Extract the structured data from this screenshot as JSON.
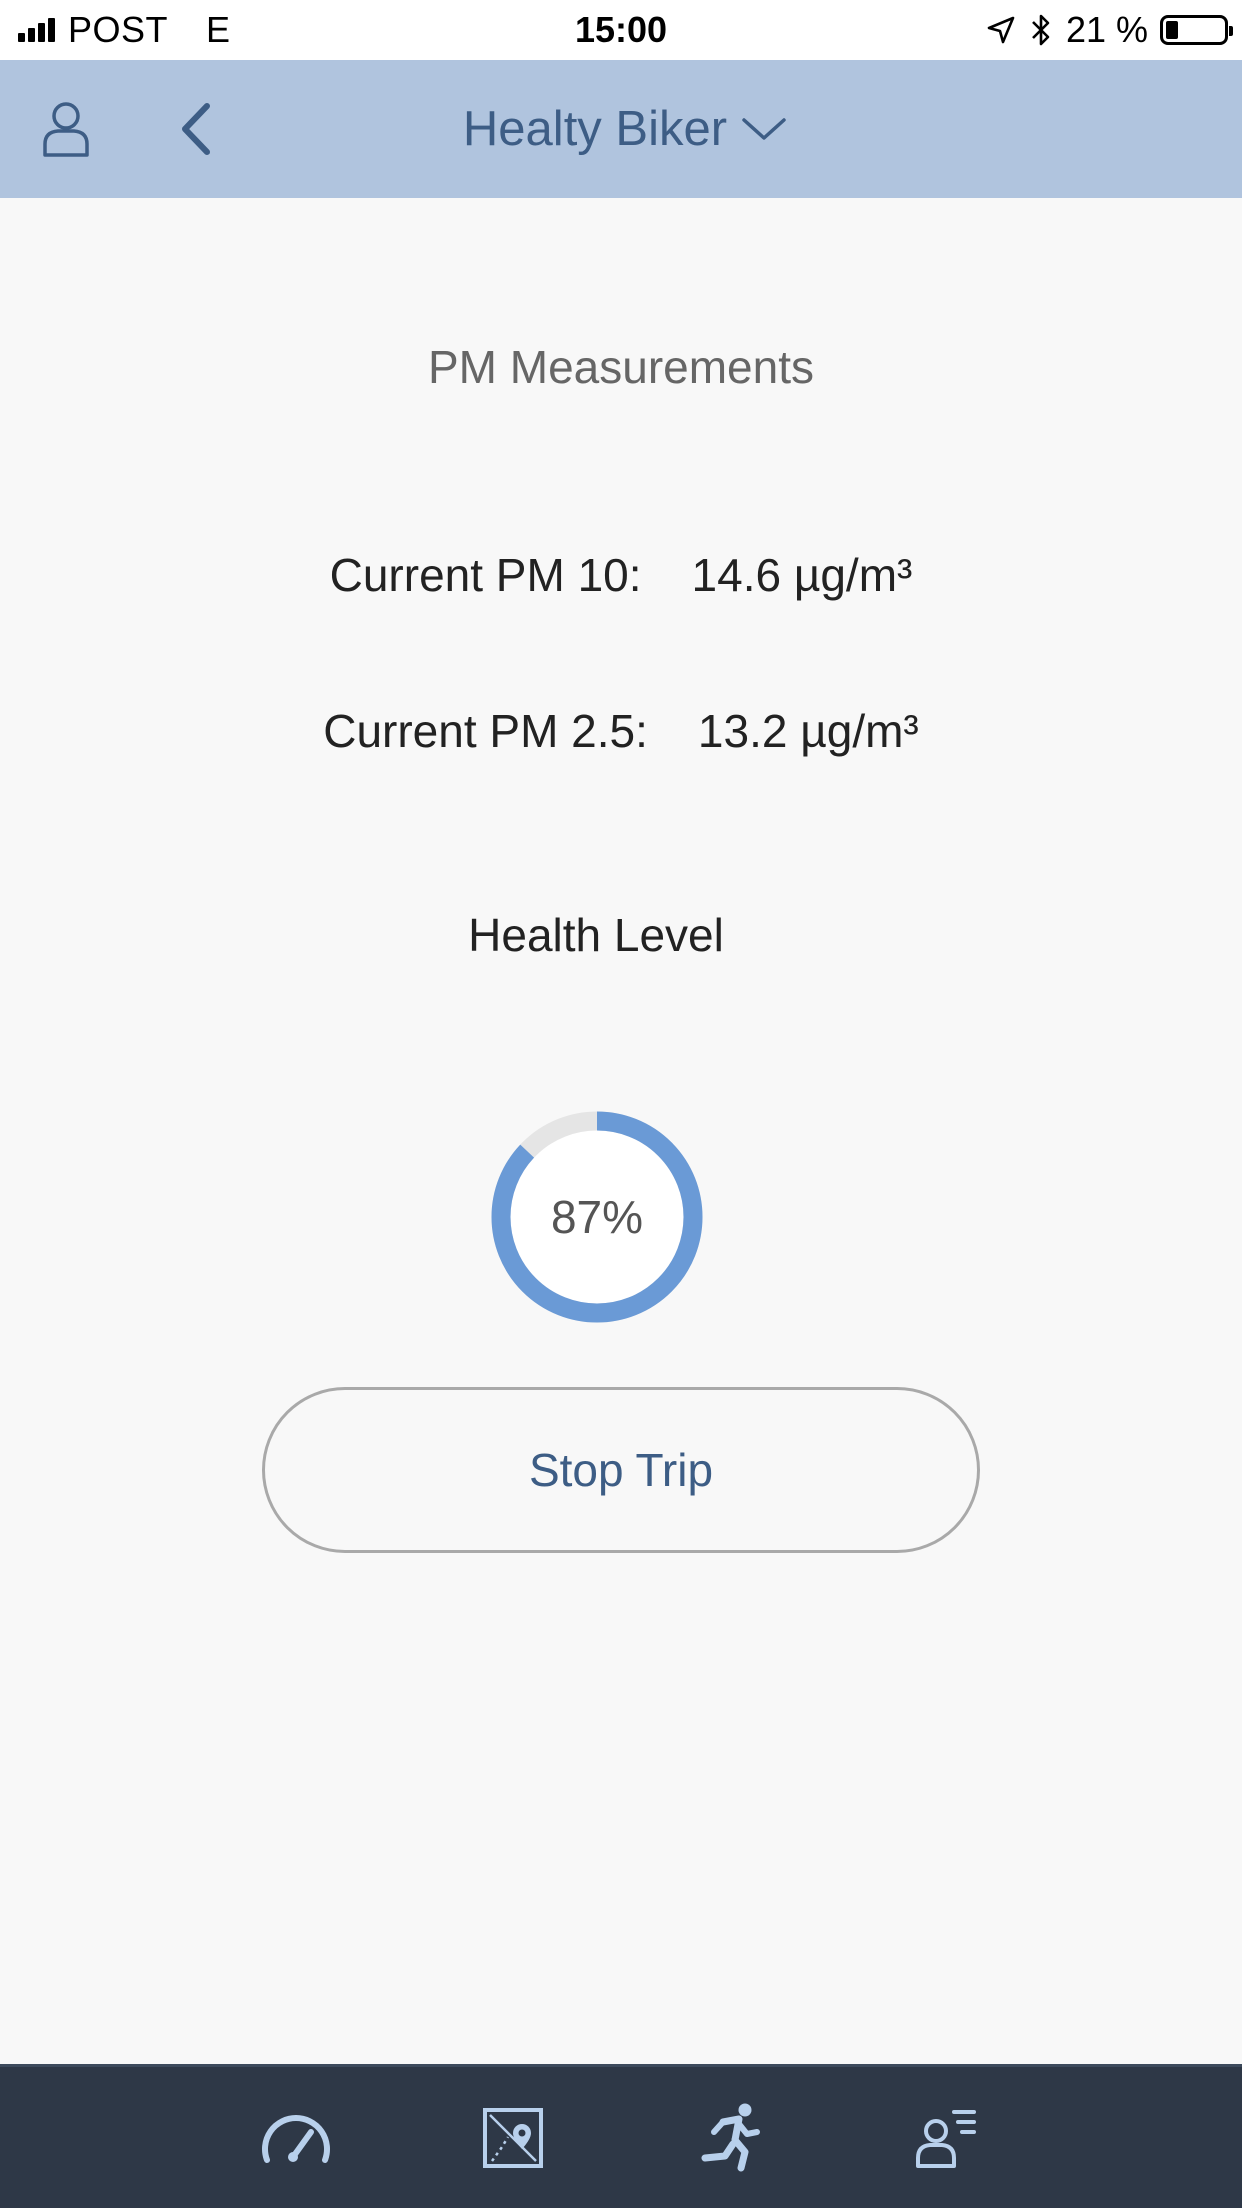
{
  "status_bar": {
    "carrier": "POST",
    "network": "E",
    "time": "15:00",
    "battery_percent": "21 %",
    "battery_level": 0.21
  },
  "header": {
    "title": "Healty Biker",
    "icons": [
      "profile-icon",
      "back-chevron-icon",
      "chevron-down-icon"
    ]
  },
  "main": {
    "section_title": "PM Measurements",
    "measurements": [
      {
        "label": "Current PM 10:",
        "value": "14.6 µg/m³"
      },
      {
        "label": "Current PM 2.5:",
        "value": "13.2 µg/m³"
      }
    ],
    "health_title": "Health Level",
    "health_level": {
      "label": "87%",
      "fraction": 0.87
    },
    "stop_button_label": "Stop Trip"
  },
  "tab_bar": {
    "tabs": [
      {
        "icon": "speedometer-icon"
      },
      {
        "icon": "map-route-icon"
      },
      {
        "icon": "running-person-icon"
      },
      {
        "icon": "user-list-icon"
      }
    ]
  },
  "colors": {
    "header_bg": "#b0c4de",
    "accent": "#3d5d85",
    "gauge_fill": "#6a9ad6",
    "gauge_track": "#e5e5e5",
    "tab_bar_bg": "#2e3847",
    "tab_icon": "#b8d0ec"
  }
}
